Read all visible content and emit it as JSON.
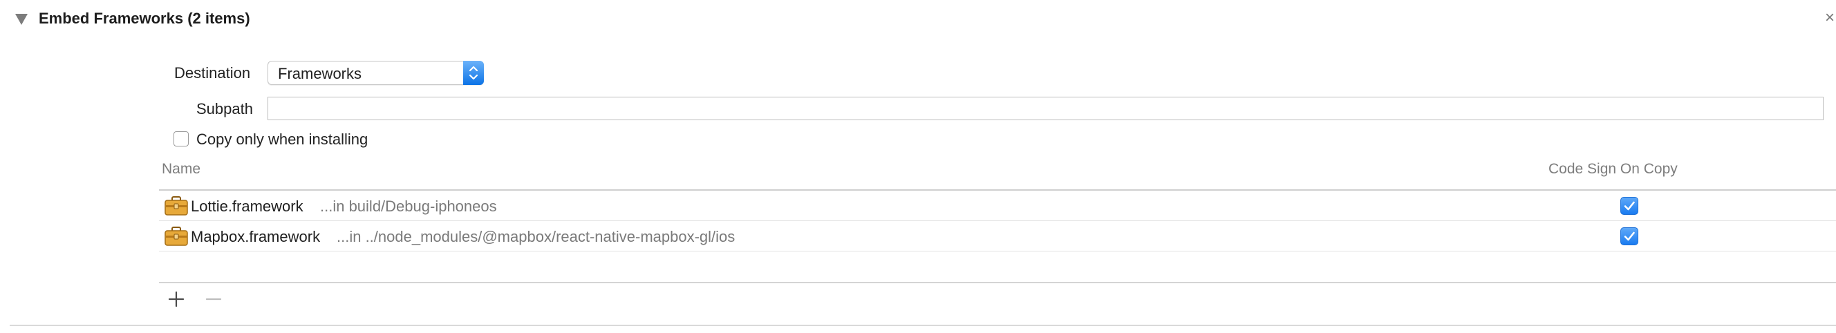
{
  "section": {
    "title": "Embed Frameworks (2 items)",
    "close_glyph": "×"
  },
  "form": {
    "destination_label": "Destination",
    "destination_value": "Frameworks",
    "subpath_label": "Subpath",
    "subpath_value": "",
    "copy_only_label": "Copy only when installing",
    "copy_only_checked": false
  },
  "table": {
    "columns": [
      "Name",
      "Code Sign On Copy"
    ],
    "rows": [
      {
        "name": "Lottie.framework",
        "path": "...in build/Debug-iphoneos",
        "code_sign_on_copy": true,
        "icon": "framework-briefcase-icon"
      },
      {
        "name": "Mapbox.framework",
        "path": "...in ../node_modules/@mapbox/react-native-mapbox-gl/ios",
        "code_sign_on_copy": true,
        "icon": "framework-briefcase-icon"
      }
    ]
  },
  "toolbar": {
    "add_icon": "plus-icon",
    "remove_icon": "minus-icon"
  },
  "colors": {
    "accent": "#1a7bf0",
    "separator": "#d9d9d9",
    "secondary_text": "#7a7a7a"
  }
}
